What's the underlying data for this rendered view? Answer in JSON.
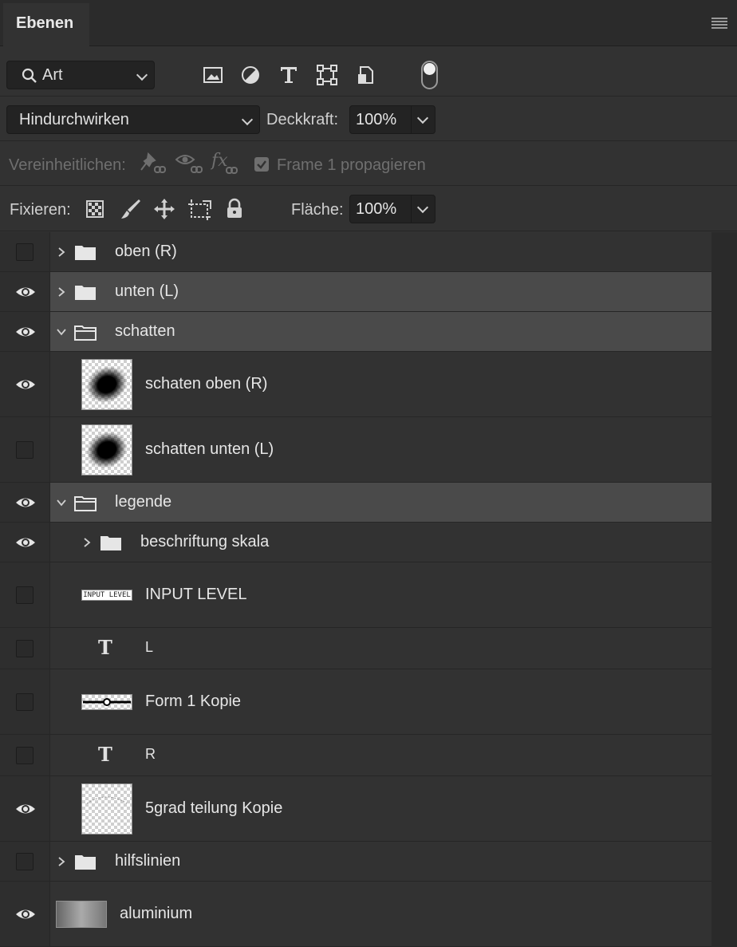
{
  "panel": {
    "tab": "Ebenen",
    "menu_icon": "panel-menu-icon"
  },
  "filter": {
    "label": "Art",
    "icons": [
      "image-filter-icon",
      "adjustment-filter-icon",
      "type-filter-icon",
      "shape-filter-icon",
      "smart-object-filter-icon"
    ],
    "toggle": "filter-toggle"
  },
  "blend": {
    "mode": "Hindurchwirken",
    "opacity_label": "Deckkraft:",
    "opacity_value": "100%"
  },
  "unify": {
    "label": "Vereinheitlichen:",
    "propagate_label": "Frame 1 propagieren",
    "propagate_checked": true
  },
  "lock": {
    "label": "Fixieren:",
    "fill_label": "Fläche:",
    "fill_value": "100%"
  },
  "layers": [
    {
      "name": "oben (R)",
      "type": "group",
      "visible": false,
      "expanded": false,
      "indent": 0
    },
    {
      "name": "unten (L)",
      "type": "group",
      "visible": true,
      "expanded": false,
      "indent": 0,
      "selected": true
    },
    {
      "name": "schatten",
      "type": "group",
      "visible": true,
      "expanded": true,
      "indent": 0,
      "selected": true
    },
    {
      "name": "schaten oben (R)",
      "type": "pixel",
      "visible": true,
      "indent": 1
    },
    {
      "name": "schatten unten (L)",
      "type": "pixel",
      "visible": false,
      "indent": 1
    },
    {
      "name": "legende",
      "type": "group",
      "visible": true,
      "expanded": true,
      "indent": 0,
      "selected": true
    },
    {
      "name": "beschriftung skala",
      "type": "group",
      "visible": true,
      "expanded": false,
      "indent": 1
    },
    {
      "name": "INPUT LEVEL",
      "type": "pixel",
      "visible": false,
      "indent": 1,
      "thumb_text": "INPUT LEVEL"
    },
    {
      "name": "L",
      "type": "text",
      "visible": false,
      "indent": 1
    },
    {
      "name": "Form 1 Kopie",
      "type": "shape",
      "visible": false,
      "indent": 1
    },
    {
      "name": "R",
      "type": "text",
      "visible": false,
      "indent": 1
    },
    {
      "name": "5grad teilung Kopie",
      "type": "pixel",
      "visible": true,
      "indent": 1
    },
    {
      "name": "hilfslinien",
      "type": "group",
      "visible": false,
      "expanded": false,
      "indent": 0
    },
    {
      "name": "aluminium",
      "type": "pixel",
      "visible": true,
      "indent": 0
    }
  ]
}
